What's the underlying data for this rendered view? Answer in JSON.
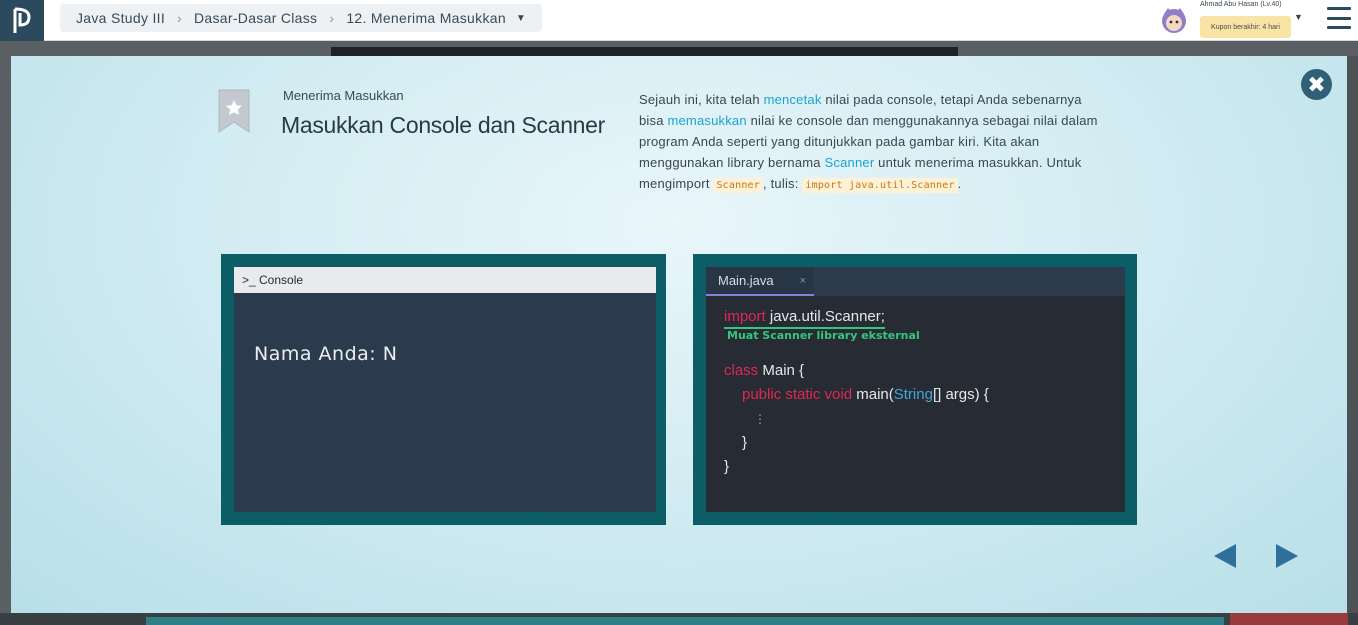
{
  "header": {
    "breadcrumb": [
      "Java Study III",
      "Dasar-Dasar Class",
      "12. Menerima Masukkan"
    ],
    "user_name": "Ahmad Abu Hasan (Lv.40)",
    "coupon": "Kupon berakhir: 4 hari"
  },
  "slide": {
    "subtitle": "Menerima Masukkan",
    "title": "Masukkan Console dan Scanner",
    "desc": {
      "p1": "Sejauh ini, kita telah ",
      "h1": "mencetak",
      "p2": " nilai pada console, tetapi Anda sebenarnya bisa ",
      "h2": "memasukkan",
      "p3": " nilai ke console dan menggunakannya sebagai nilai dalam program Anda seperti yang ditunjukkan pada gambar kiri. Kita akan menggunakan library bernama ",
      "h3": "Scanner",
      "p4": " untuk menerima masukkan. Untuk mengimport ",
      "c1": "Scanner",
      "p5": ", tulis: ",
      "c2": "import java.util.Scanner",
      "p6": "."
    },
    "console": {
      "header": ">_ Console",
      "output": "Nama Anda: N"
    },
    "code": {
      "tab": "Main.java",
      "tab_close": "×",
      "import_kw": "import",
      "import_rest": " java.util.Scanner;",
      "note": "Muat Scanner library eksternal",
      "class_kw": "class",
      "class_rest": " Main {",
      "method_kw": "public static void",
      "method_name": " main(",
      "method_type": "String",
      "method_rest": "[] args) {",
      "dots": "⋮",
      "close_inner": "}",
      "close_outer": "}"
    }
  },
  "colors": {
    "accent": "#1aa3d1",
    "keyword": "#e02655",
    "type": "#42a5d8",
    "note": "#34c77b",
    "panel": "#0d5d66"
  }
}
